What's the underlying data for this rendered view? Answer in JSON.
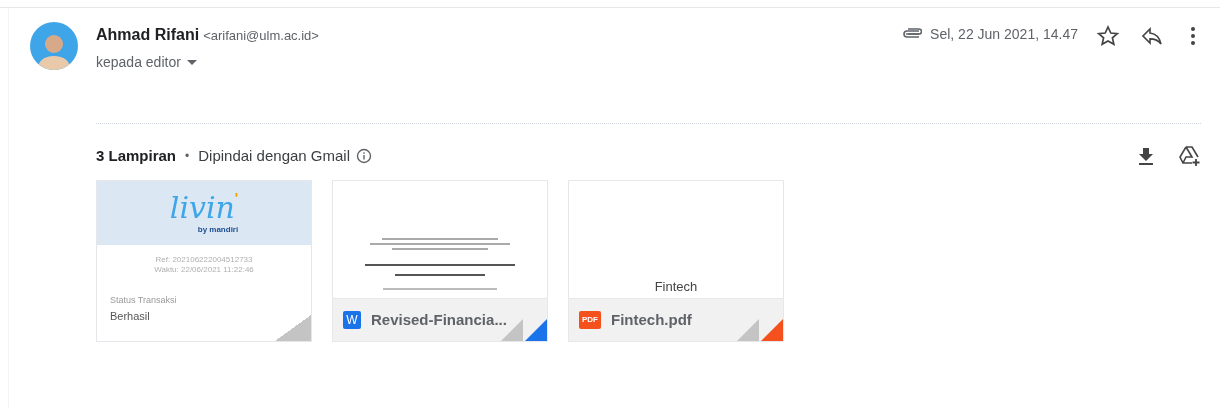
{
  "message": {
    "sender_name": "Ahmad Rifani",
    "sender_email": "<arifani@ulm.ac.id>",
    "recipient": "kepada editor",
    "date": "Sel, 22 Jun 2021, 14.47",
    "starred": false
  },
  "attachments_header": {
    "count": "3 Lampiran",
    "separator": "•",
    "scan_note": "Dipindai dengan Gmail"
  },
  "attachments": [
    {
      "kind": "image",
      "logo": "livin",
      "logo_dot": "'",
      "logo_sub": "by mandiri",
      "lines": [
        "Ref: 202106222004512733",
        "Waktu: 22/06/2021 11:22:46"
      ],
      "status_label": "Status Transaksi",
      "status_value": "Berhasil"
    },
    {
      "kind": "doc",
      "badge": "W",
      "filename": "Revised-Financia...",
      "color": "#1a73e8"
    },
    {
      "kind": "pdf",
      "badge": "PDF",
      "filename": "Fintech.pdf",
      "preview_lines": [
        "Fintech"
      ],
      "color": "#f4511e"
    }
  ]
}
